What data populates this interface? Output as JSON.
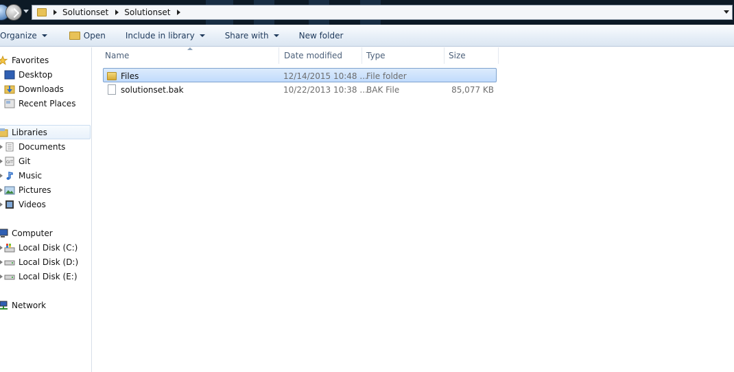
{
  "address_bar": {
    "breadcrumbs": [
      "Solutionset",
      "Solutionset"
    ]
  },
  "toolbar": {
    "organize": "Organize",
    "open": "Open",
    "include_in_library": "Include in library",
    "share_with": "Share with",
    "new_folder": "New folder"
  },
  "nav_pane": {
    "favorites": {
      "label": "Favorites",
      "items": [
        "Desktop",
        "Downloads",
        "Recent Places"
      ]
    },
    "libraries": {
      "label": "Libraries",
      "items": [
        "Documents",
        "Git",
        "Music",
        "Pictures",
        "Videos"
      ]
    },
    "computer": {
      "label": "Computer",
      "items": [
        "Local Disk (C:)",
        "Local Disk (D:)",
        "Local Disk (E:)"
      ]
    },
    "network": {
      "label": "Network"
    }
  },
  "file_list": {
    "columns": [
      "Name",
      "Date modified",
      "Type",
      "Size"
    ],
    "rows": [
      {
        "name": "Files",
        "date_modified": "12/14/2015 10:48 ...",
        "type": "File folder",
        "size": "",
        "selected": true,
        "icon": "folder-icon"
      },
      {
        "name": "solutionset.bak",
        "date_modified": "10/22/2013 10:38 ...",
        "type": "BAK File",
        "size": "85,077 KB",
        "selected": false,
        "icon": "file-icon"
      }
    ]
  }
}
